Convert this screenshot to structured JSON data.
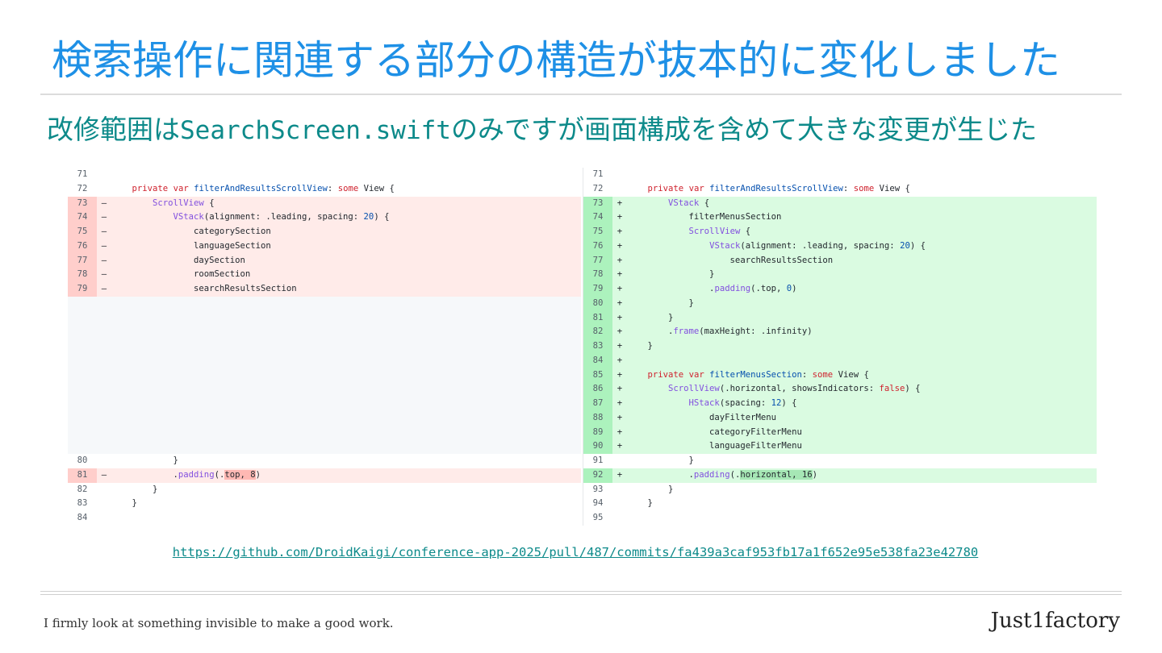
{
  "slide": {
    "title": "検索操作に関連する部分の構造が抜本的に変化しました",
    "subtitle_pre": "改修範囲は",
    "subtitle_code": "SearchScreen.swift",
    "subtitle_post": "のみですが画面構成を含めて大きな変更が生じた",
    "link": "https://github.com/DroidKaigi/conference-app-2025/pull/487/commits/fa439a3caf953fb17a1f652e95e538fa23e42780",
    "footer_tagline": "I firmly look at something invisible to make a good work.",
    "footer_brand": "Just1factory"
  },
  "diff": {
    "left": [
      {
        "t": "ctx",
        "n": "71",
        "m": "",
        "c": ""
      },
      {
        "t": "ctx",
        "n": "72",
        "m": "",
        "c": "    <k>private</k> <k>var</k> <p>filterAndResultsScrollView</p>: <k>some</k> View {"
      },
      {
        "t": "del",
        "n": "73",
        "m": "–",
        "c": "        <f>ScrollView</f> {"
      },
      {
        "t": "del",
        "n": "74",
        "m": "–",
        "c": "            <f>VStack</f>(alignment: .leading, spacing: <u>20</u>) {"
      },
      {
        "t": "del",
        "n": "75",
        "m": "–",
        "c": "                categorySection"
      },
      {
        "t": "del",
        "n": "76",
        "m": "–",
        "c": "                languageSection"
      },
      {
        "t": "del",
        "n": "77",
        "m": "–",
        "c": "                daySection"
      },
      {
        "t": "del",
        "n": "78",
        "m": "–",
        "c": "                roomSection"
      },
      {
        "t": "del",
        "n": "79",
        "m": "–",
        "c": "                searchResultsSection"
      },
      {
        "t": "empty",
        "n": "",
        "m": "",
        "c": ""
      },
      {
        "t": "empty",
        "n": "",
        "m": "",
        "c": ""
      },
      {
        "t": "empty",
        "n": "",
        "m": "",
        "c": ""
      },
      {
        "t": "empty",
        "n": "",
        "m": "",
        "c": ""
      },
      {
        "t": "empty",
        "n": "",
        "m": "",
        "c": ""
      },
      {
        "t": "empty",
        "n": "",
        "m": "",
        "c": ""
      },
      {
        "t": "empty",
        "n": "",
        "m": "",
        "c": ""
      },
      {
        "t": "empty",
        "n": "",
        "m": "",
        "c": ""
      },
      {
        "t": "empty",
        "n": "",
        "m": "",
        "c": ""
      },
      {
        "t": "empty",
        "n": "",
        "m": "",
        "c": ""
      },
      {
        "t": "empty",
        "n": "",
        "m": "",
        "c": ""
      },
      {
        "t": "ctx",
        "n": "80",
        "m": "",
        "c": "            }"
      },
      {
        "t": "del",
        "n": "81",
        "m": "–",
        "c": "            .<f>padding</f>(.<x>top, 8</x>)"
      },
      {
        "t": "ctx",
        "n": "82",
        "m": "",
        "c": "        }"
      },
      {
        "t": "ctx",
        "n": "83",
        "m": "",
        "c": "    }"
      },
      {
        "t": "ctx",
        "n": "84",
        "m": "",
        "c": ""
      }
    ],
    "right": [
      {
        "t": "ctx",
        "n": "71",
        "m": "",
        "c": ""
      },
      {
        "t": "ctx",
        "n": "72",
        "m": "",
        "c": "    <k>private</k> <k>var</k> <p>filterAndResultsScrollView</p>: <k>some</k> View {"
      },
      {
        "t": "add",
        "n": "73",
        "m": "+",
        "c": "        <f>VStack</f> {"
      },
      {
        "t": "add",
        "n": "74",
        "m": "+",
        "c": "            filterMenusSection"
      },
      {
        "t": "add",
        "n": "75",
        "m": "+",
        "c": "            <f>ScrollView</f> {"
      },
      {
        "t": "add",
        "n": "76",
        "m": "+",
        "c": "                <f>VStack</f>(alignment: .leading, spacing: <u>20</u>) {"
      },
      {
        "t": "add",
        "n": "77",
        "m": "+",
        "c": "                    searchResultsSection"
      },
      {
        "t": "add",
        "n": "78",
        "m": "+",
        "c": "                }"
      },
      {
        "t": "add",
        "n": "79",
        "m": "+",
        "c": "                .<f>padding</f>(.top, <u>0</u>)"
      },
      {
        "t": "add",
        "n": "80",
        "m": "+",
        "c": "            }"
      },
      {
        "t": "add",
        "n": "81",
        "m": "+",
        "c": "        }"
      },
      {
        "t": "add",
        "n": "82",
        "m": "+",
        "c": "        .<f>frame</f>(maxHeight: .infinity)"
      },
      {
        "t": "add",
        "n": "83",
        "m": "+",
        "c": "    }"
      },
      {
        "t": "add",
        "n": "84",
        "m": "+",
        "c": ""
      },
      {
        "t": "add",
        "n": "85",
        "m": "+",
        "c": "    <k>private</k> <k>var</k> <p>filterMenusSection</p>: <k>some</k> View {"
      },
      {
        "t": "add",
        "n": "86",
        "m": "+",
        "c": "        <f>ScrollView</f>(.horizontal, showsIndicators: <k>false</k>) {"
      },
      {
        "t": "add",
        "n": "87",
        "m": "+",
        "c": "            <f>HStack</f>(spacing: <u>12</u>) {"
      },
      {
        "t": "add",
        "n": "88",
        "m": "+",
        "c": "                dayFilterMenu"
      },
      {
        "t": "add",
        "n": "89",
        "m": "+",
        "c": "                categoryFilterMenu"
      },
      {
        "t": "add",
        "n": "90",
        "m": "+",
        "c": "                languageFilterMenu"
      },
      {
        "t": "ctx",
        "n": "91",
        "m": "",
        "c": "            }"
      },
      {
        "t": "add",
        "n": "92",
        "m": "+",
        "c": "            .<f>padding</f>(.<y>horizontal, 16</y>)"
      },
      {
        "t": "ctx",
        "n": "93",
        "m": "",
        "c": "        }"
      },
      {
        "t": "ctx",
        "n": "94",
        "m": "",
        "c": "    }"
      },
      {
        "t": "ctx",
        "n": "95",
        "m": "",
        "c": ""
      }
    ]
  }
}
